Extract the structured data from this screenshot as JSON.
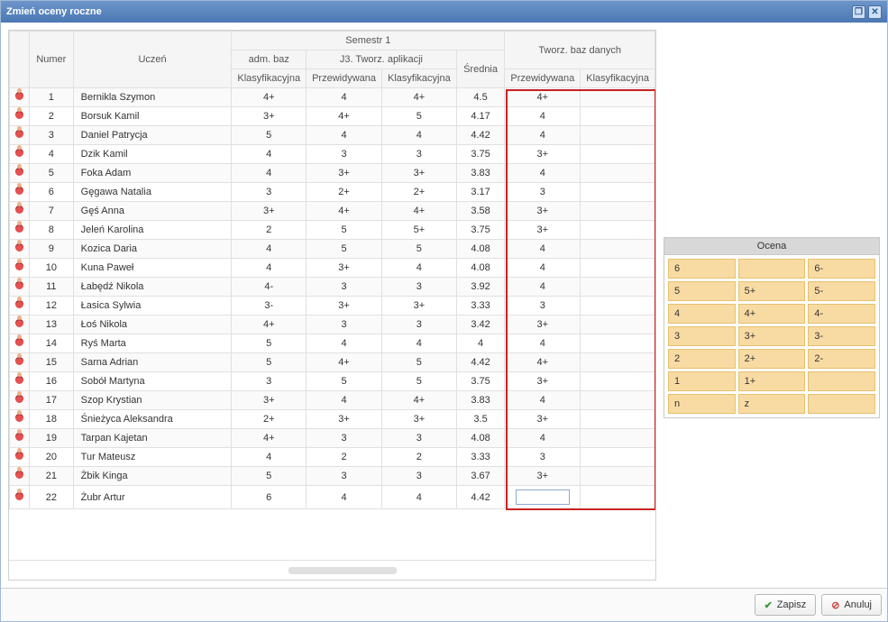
{
  "window": {
    "title": "Zmień oceny roczne"
  },
  "headers": {
    "semester": "Semestr 1",
    "numer": "Numer",
    "uczen": "Uczeń",
    "group_adm": "adm. baz",
    "group_j3": "J3. Tworz. aplikacji",
    "group_tbd": "Tworz. baz danych",
    "klasyf": "Klasyfikacyjna",
    "przew": "Przewidywana",
    "sred": "Średnia"
  },
  "students": [
    {
      "num": 1,
      "name": "Bernikla Szymon",
      "adm_k": "4+",
      "j3_p": "4",
      "j3_k": "4+",
      "sred": "4.5",
      "tbd_p": "4+",
      "tbd_k": ""
    },
    {
      "num": 2,
      "name": "Borsuk Kamil",
      "adm_k": "3+",
      "j3_p": "4+",
      "j3_k": "5",
      "sred": "4.17",
      "tbd_p": "4",
      "tbd_k": ""
    },
    {
      "num": 3,
      "name": "Daniel Patrycja",
      "adm_k": "5",
      "j3_p": "4",
      "j3_k": "4",
      "sred": "4.42",
      "tbd_p": "4",
      "tbd_k": ""
    },
    {
      "num": 4,
      "name": "Dzik Kamil",
      "adm_k": "4",
      "j3_p": "3",
      "j3_k": "3",
      "sred": "3.75",
      "tbd_p": "3+",
      "tbd_k": ""
    },
    {
      "num": 5,
      "name": "Foka Adam",
      "adm_k": "4",
      "j3_p": "3+",
      "j3_k": "3+",
      "sred": "3.83",
      "tbd_p": "4",
      "tbd_k": ""
    },
    {
      "num": 6,
      "name": "Gęgawa Natalia",
      "adm_k": "3",
      "j3_p": "2+",
      "j3_k": "2+",
      "sred": "3.17",
      "tbd_p": "3",
      "tbd_k": ""
    },
    {
      "num": 7,
      "name": "Gęś Anna",
      "adm_k": "3+",
      "j3_p": "4+",
      "j3_k": "4+",
      "sred": "3.58",
      "tbd_p": "3+",
      "tbd_k": ""
    },
    {
      "num": 8,
      "name": "Jeleń Karolina",
      "adm_k": "2",
      "j3_p": "5",
      "j3_k": "5+",
      "sred": "3.75",
      "tbd_p": "3+",
      "tbd_k": ""
    },
    {
      "num": 9,
      "name": "Kozica Daria",
      "adm_k": "4",
      "j3_p": "5",
      "j3_k": "5",
      "sred": "4.08",
      "tbd_p": "4",
      "tbd_k": ""
    },
    {
      "num": 10,
      "name": "Kuna Paweł",
      "adm_k": "4",
      "j3_p": "3+",
      "j3_k": "4",
      "sred": "4.08",
      "tbd_p": "4",
      "tbd_k": ""
    },
    {
      "num": 11,
      "name": "Łabędź Nikola",
      "adm_k": "4-",
      "j3_p": "3",
      "j3_k": "3",
      "sred": "3.92",
      "tbd_p": "4",
      "tbd_k": ""
    },
    {
      "num": 12,
      "name": "Łasica Sylwia",
      "adm_k": "3-",
      "j3_p": "3+",
      "j3_k": "3+",
      "sred": "3.33",
      "tbd_p": "3",
      "tbd_k": ""
    },
    {
      "num": 13,
      "name": "Łoś Nikola",
      "adm_k": "4+",
      "j3_p": "3",
      "j3_k": "3",
      "sred": "3.42",
      "tbd_p": "3+",
      "tbd_k": ""
    },
    {
      "num": 14,
      "name": "Ryś Marta",
      "adm_k": "5",
      "j3_p": "4",
      "j3_k": "4",
      "sred": "4",
      "tbd_p": "4",
      "tbd_k": ""
    },
    {
      "num": 15,
      "name": "Sarna Adrian",
      "adm_k": "5",
      "j3_p": "4+",
      "j3_k": "5",
      "sred": "4.42",
      "tbd_p": "4+",
      "tbd_k": ""
    },
    {
      "num": 16,
      "name": "Sobół Martyna",
      "adm_k": "3",
      "j3_p": "5",
      "j3_k": "5",
      "sred": "3.75",
      "tbd_p": "3+",
      "tbd_k": ""
    },
    {
      "num": 17,
      "name": "Szop Krystian",
      "adm_k": "3+",
      "j3_p": "4",
      "j3_k": "4+",
      "sred": "3.83",
      "tbd_p": "4",
      "tbd_k": ""
    },
    {
      "num": 18,
      "name": "Śnieżyca Aleksandra",
      "adm_k": "2+",
      "j3_p": "3+",
      "j3_k": "3+",
      "sred": "3.5",
      "tbd_p": "3+",
      "tbd_k": ""
    },
    {
      "num": 19,
      "name": "Tarpan Kajetan",
      "adm_k": "4+",
      "j3_p": "3",
      "j3_k": "3",
      "sred": "4.08",
      "tbd_p": "4",
      "tbd_k": ""
    },
    {
      "num": 20,
      "name": "Tur Mateusz",
      "adm_k": "4",
      "j3_p": "2",
      "j3_k": "2",
      "sred": "3.33",
      "tbd_p": "3",
      "tbd_k": ""
    },
    {
      "num": 21,
      "name": "Żbik Kinga",
      "adm_k": "5",
      "j3_p": "3",
      "j3_k": "3",
      "sred": "3.67",
      "tbd_p": "3+",
      "tbd_k": ""
    },
    {
      "num": 22,
      "name": "Żubr Artur",
      "adm_k": "6",
      "j3_p": "4",
      "j3_k": "4",
      "sred": "4.42",
      "tbd_p": "__input__",
      "tbd_k": ""
    }
  ],
  "gradePanel": {
    "title": "Ocena",
    "rows": [
      [
        "6",
        "",
        "6-"
      ],
      [
        "5",
        "5+",
        "5-"
      ],
      [
        "4",
        "4+",
        "4-"
      ],
      [
        "3",
        "3+",
        "3-"
      ],
      [
        "2",
        "2+",
        "2-"
      ],
      [
        "1",
        "1+",
        ""
      ],
      [
        "n",
        "z",
        ""
      ]
    ]
  },
  "footer": {
    "save": "Zapisz",
    "cancel": "Anuluj"
  }
}
